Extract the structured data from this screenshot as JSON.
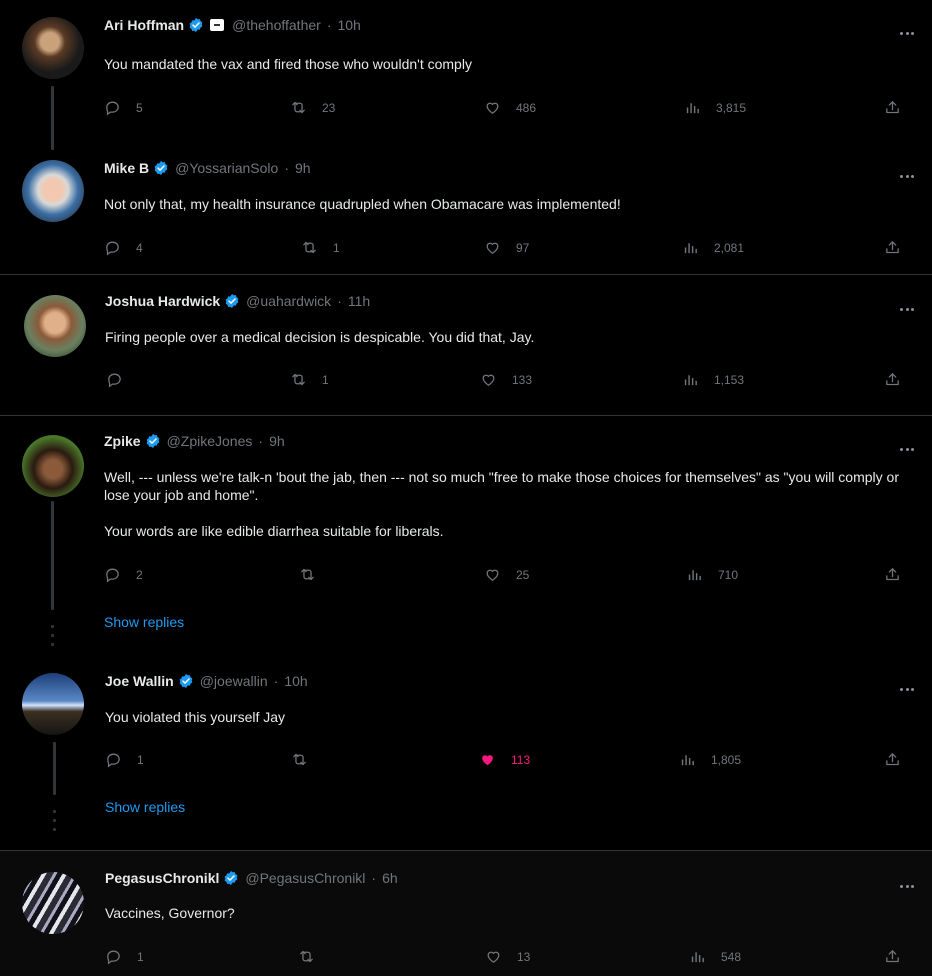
{
  "colors": {
    "accent": "#1d9bf0",
    "like": "#f91880",
    "muted": "#71767b"
  },
  "show_replies_label": "Show replies",
  "posts": [
    {
      "name": "Ari Hoffman",
      "handle": "@thehoffather",
      "time": "10h",
      "verified": true,
      "affiliation_badge": true,
      "text": [
        "You mandated the vax and fired those who wouldn't comply"
      ],
      "replies": "5",
      "reposts": "23",
      "likes": "486",
      "views": "3,815",
      "liked": false
    },
    {
      "name": "Mike B",
      "handle": "@YossarianSolo",
      "time": "9h",
      "verified": true,
      "text": [
        "Not only that, my health insurance quadrupled when Obamacare was implemented!"
      ],
      "replies": "4",
      "reposts": "1",
      "likes": "97",
      "views": "2,081",
      "liked": false
    },
    {
      "name": "Joshua Hardwick",
      "handle": "@uahardwick",
      "time": "11h",
      "verified": true,
      "text": [
        "Firing people over a medical decision is despicable. You did that, Jay."
      ],
      "replies": "",
      "reposts": "1",
      "likes": "133",
      "views": "1,153",
      "liked": false
    },
    {
      "name": "Zpike",
      "handle": "@ZpikeJones",
      "time": "9h",
      "verified": true,
      "text": [
        "Well, --- unless we're talk-n 'bout the jab, then --- not so much \"free to make those choices for themselves\" as \"you will comply or lose your job and home\".",
        "Your words are like edible diarrhea suitable for liberals."
      ],
      "replies": "2",
      "reposts": "",
      "likes": "25",
      "views": "710",
      "liked": false
    },
    {
      "name": "Joe Wallin",
      "handle": "@joewallin",
      "time": "10h",
      "verified": true,
      "text": [
        "You violated this yourself Jay"
      ],
      "replies": "1",
      "reposts": "",
      "likes": "113",
      "views": "1,805",
      "liked": true
    },
    {
      "name": "PegasusChronikl",
      "handle": "@PegasusChronikl",
      "time": "6h",
      "verified": true,
      "text": [
        "Vaccines, Governor?"
      ],
      "replies": "1",
      "reposts": "",
      "likes": "13",
      "views": "548",
      "liked": false
    }
  ],
  "icons": [
    "verified-badge-icon",
    "reply-icon",
    "repost-icon",
    "like-icon",
    "views-icon",
    "share-icon",
    "more-icon"
  ]
}
